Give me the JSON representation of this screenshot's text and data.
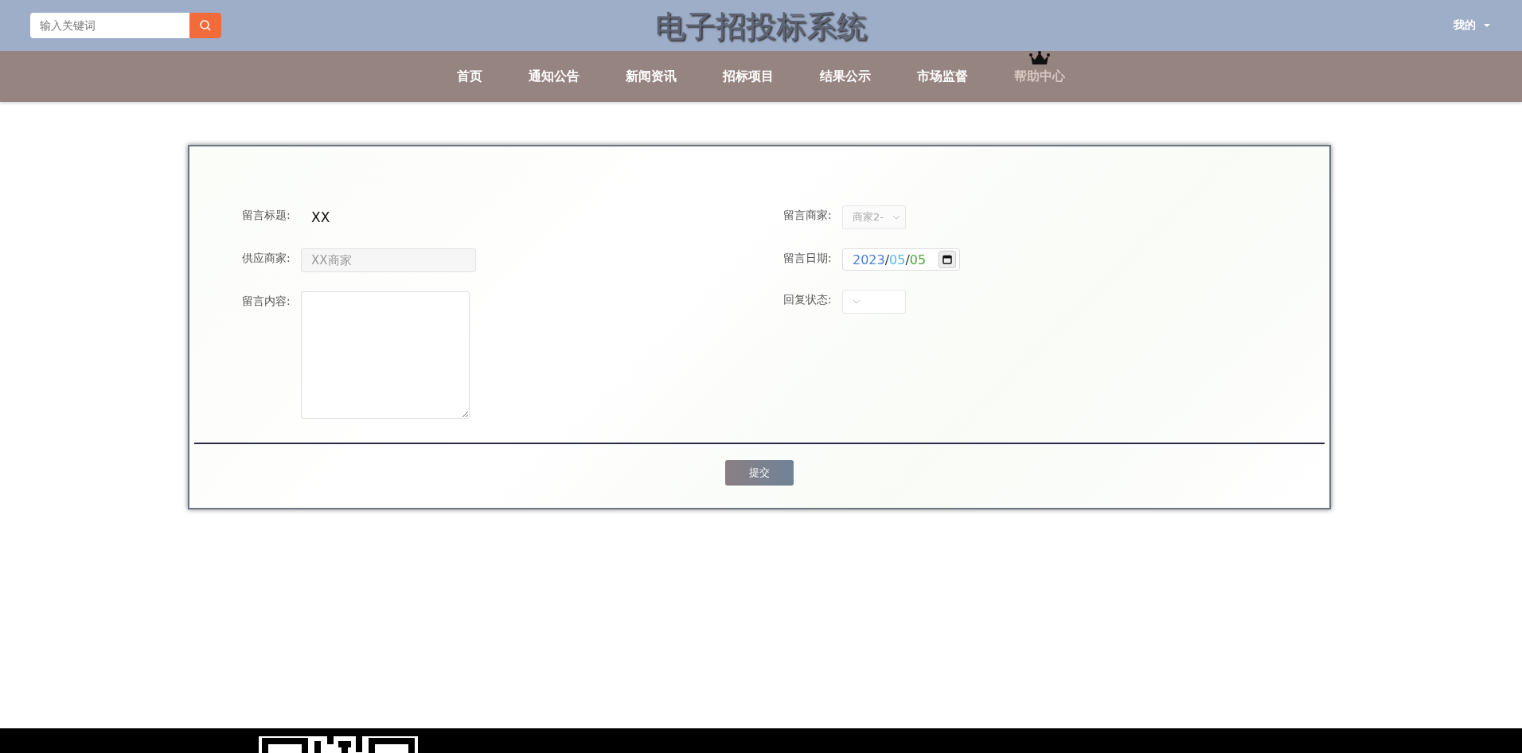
{
  "header": {
    "search": {
      "placeholder": "输入关键词"
    },
    "title": "电子招投标系统",
    "user_menu": "我的"
  },
  "nav": [
    {
      "label": "首页",
      "selected": false
    },
    {
      "label": "通知公告",
      "selected": false
    },
    {
      "label": "新闻资讯",
      "selected": false
    },
    {
      "label": "招标项目",
      "selected": false
    },
    {
      "label": "结果公示",
      "selected": false
    },
    {
      "label": "市场监督",
      "selected": false
    },
    {
      "label": "帮助中心",
      "selected": true
    }
  ],
  "form": {
    "left": [
      {
        "kind": "text",
        "label": "留言标题:",
        "value": "XX",
        "disabled": false
      },
      {
        "kind": "text",
        "label": "供应商家:",
        "value": "XX商家",
        "disabled": true
      },
      {
        "kind": "textarea",
        "label": "留言内容:"
      }
    ],
    "right": [
      {
        "kind": "select",
        "label": "留言商家:",
        "value": "商家2-",
        "disabled": true
      },
      {
        "kind": "date",
        "label": "留言日期:",
        "value": "2023/05/05",
        "disabled": false
      },
      {
        "kind": "select",
        "label": "回复状态:"
      }
    ],
    "submit": "提交"
  }
}
